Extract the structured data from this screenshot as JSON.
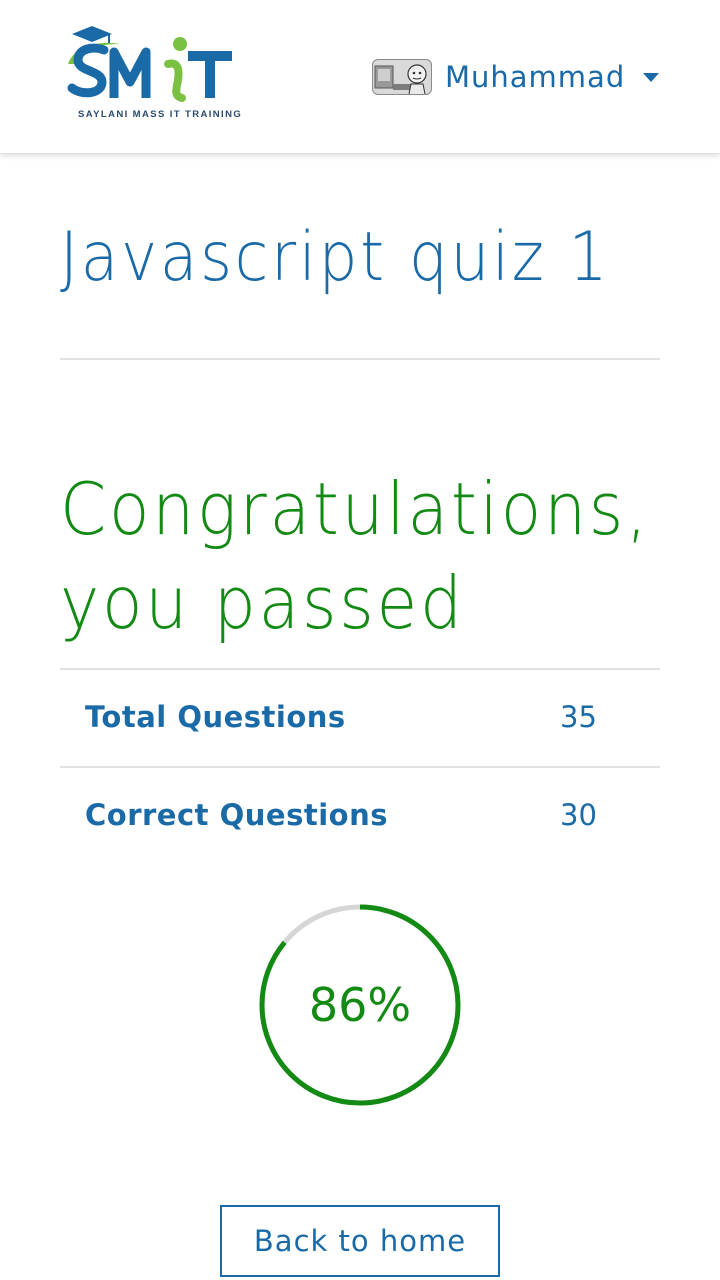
{
  "brand": {
    "logo_text": "SMIT",
    "tagline": "SAYLANI MASS IT TRAINING"
  },
  "user": {
    "name": "Muhammad",
    "avatar": "user-avatar-image"
  },
  "quiz": {
    "title": "Javascript quiz 1"
  },
  "result": {
    "message": "Congratulations, you passed",
    "stats": [
      {
        "label": "Total Questions",
        "value": "35"
      },
      {
        "label": "Correct Questions",
        "value": "30"
      }
    ],
    "score_text": "86%",
    "score_fraction": 0.86
  },
  "actions": {
    "back_label": "Back to home"
  },
  "colors": {
    "brand_blue": "#1a6aa8",
    "success_green": "#138a13",
    "logo_green": "#7ac142",
    "track_gray": "#d6d6d6"
  }
}
